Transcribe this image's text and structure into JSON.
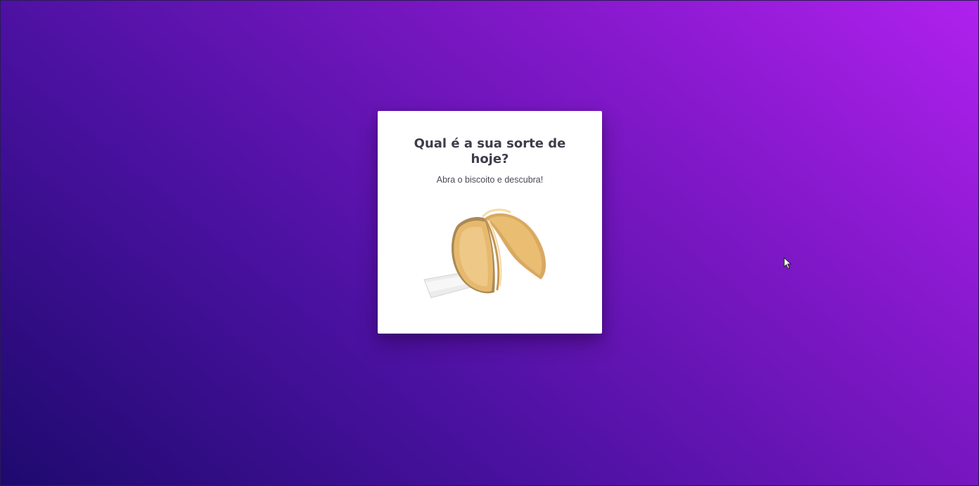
{
  "card": {
    "title": "Qual é a sua sorte de hoje?",
    "subtitle": "Abra o biscoito e descubra!"
  },
  "cookie": {
    "icon": "fortune-cookie-icon"
  },
  "colors": {
    "background_start": "#1e0a6e",
    "background_end": "#b021ee",
    "card": "#ffffff",
    "title": "#3d3d4a",
    "cookie": "#e9bd72"
  }
}
